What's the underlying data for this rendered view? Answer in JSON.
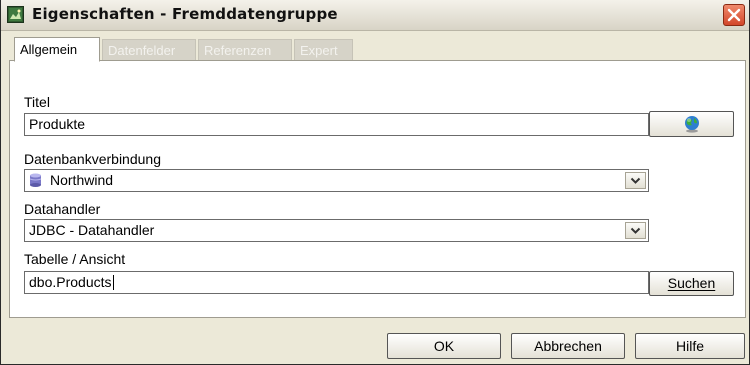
{
  "window": {
    "title": "Eigenschaften - Fremddatengruppe",
    "app_icon": "dialog-app-icon",
    "close_icon": "close-icon"
  },
  "tabs": [
    {
      "label": "Allgemein",
      "active": true
    },
    {
      "label": "Datenfelder",
      "active": false
    },
    {
      "label": "Referenzen",
      "active": false
    },
    {
      "label": "Expert",
      "active": false
    }
  ],
  "form": {
    "titel_label": "Titel",
    "titel_value": "Produkte",
    "titel_button_icon": "globe-icon",
    "datenbank_label": "Datenbankverbindung",
    "datenbank_value": "Northwind",
    "datenbank_icon": "database-icon",
    "datahandler_label": "Datahandler",
    "datahandler_value": "JDBC - Datahandler",
    "tabelle_label": "Tabelle / Ansicht",
    "tabelle_value": "dbo.Products",
    "suchen_label": "Suchen"
  },
  "buttons": {
    "ok": "OK",
    "abbrechen": "Abbrechen",
    "hilfe": "Hilfe"
  },
  "colors": {
    "dialog_bg": "#ece9d8",
    "close_button": "#d2462a",
    "inactive_tab_text": "#f3f2ee"
  }
}
